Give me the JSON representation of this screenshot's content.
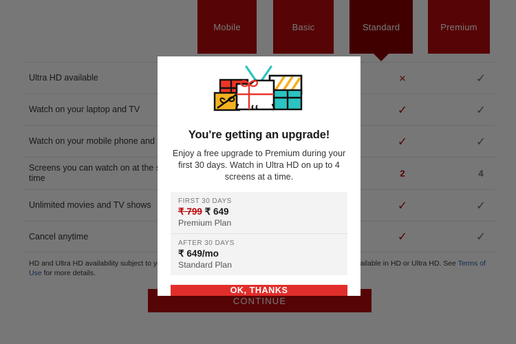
{
  "background_page": {
    "plans": [
      {
        "name": "Mobile",
        "selected": false
      },
      {
        "name": "Basic",
        "selected": false
      },
      {
        "name": "Standard",
        "selected": true
      },
      {
        "name": "Premium",
        "selected": false
      }
    ],
    "features": [
      {
        "name": "Ultra HD available",
        "mobile": "",
        "basic": "",
        "standard": "×",
        "premium": "✓"
      },
      {
        "name": "Watch on your laptop and TV",
        "mobile": "",
        "basic": "",
        "standard": "✓",
        "premium": "✓"
      },
      {
        "name": "Watch on your mobile phone and tablet",
        "mobile": "",
        "basic": "",
        "standard": "✓",
        "premium": "✓"
      },
      {
        "name": "Screens you can watch on at the same time",
        "mobile": "",
        "basic": "",
        "standard": "2",
        "premium": "4"
      },
      {
        "name": "Unlimited movies and TV shows",
        "mobile": "",
        "basic": "",
        "standard": "✓",
        "premium": "✓"
      },
      {
        "name": "Cancel anytime",
        "mobile": "",
        "basic": "",
        "standard": "✓",
        "premium": "✓"
      }
    ],
    "footnote": {
      "text_before_link": "HD and Ultra HD availability subject to your internet service and device capabilities. Not all content is available in HD or Ultra HD. See ",
      "link_text": "Terms of Use",
      "text_after_link": " for more details."
    },
    "continue_label": "CONTINUE"
  },
  "modal": {
    "illustration_name": "gift-boxes-illustration",
    "title": "You're getting an upgrade!",
    "body": "Enjoy a free upgrade to Premium during your first 30 days. Watch in Ultra HD on up to 4 screens at a time.",
    "pricing": [
      {
        "term": "FIRST 30 DAYS",
        "old_price": "₹ 799",
        "price": "₹ 649",
        "plan": "Premium Plan"
      },
      {
        "term": "AFTER 30 DAYS",
        "old_price": "",
        "price": "₹ 649/mo",
        "plan": "Standard Plan"
      }
    ],
    "confirm_label": "OK, THANKS"
  },
  "colors": {
    "brand_red": "#b9090b",
    "selected_red": "#8b0000",
    "button_red": "#e12e2b",
    "link_blue": "#2a5db0",
    "scrim": "rgba(0,0,0,0.535)"
  }
}
